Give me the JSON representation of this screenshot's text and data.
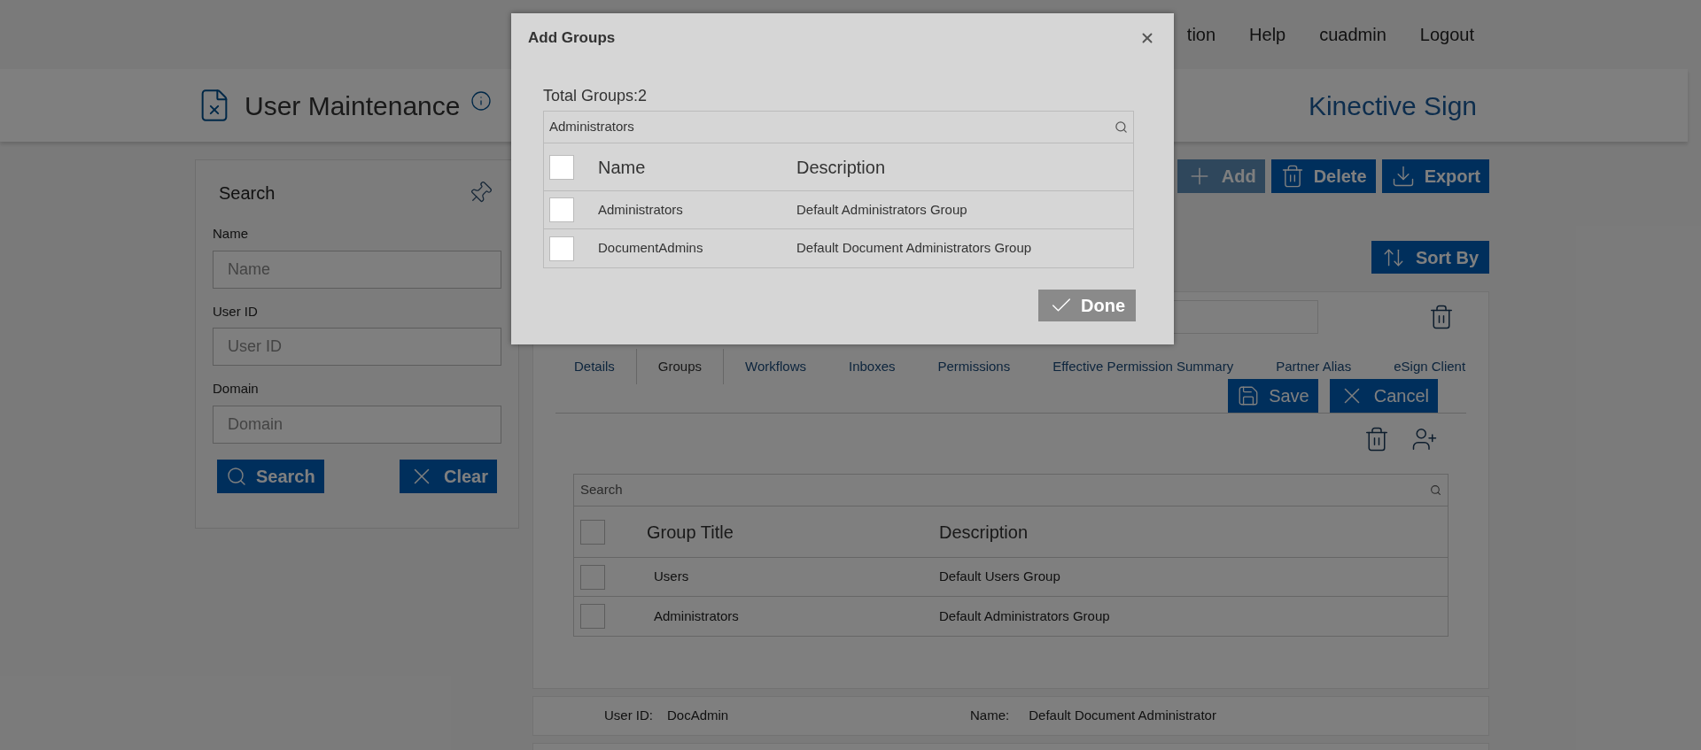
{
  "nav": [
    "tion",
    "Help",
    "cuadmin",
    "Logout"
  ],
  "header": {
    "title": "User Maintenance",
    "brand": "Kinective Sign"
  },
  "search_panel": {
    "title": "Search",
    "fields": [
      {
        "label": "Name",
        "placeholder": "Name"
      },
      {
        "label": "User ID",
        "placeholder": "User ID"
      },
      {
        "label": "Domain",
        "placeholder": "Domain"
      }
    ],
    "buttons": [
      {
        "label": "Search",
        "kind": "search"
      },
      {
        "label": "Clear",
        "kind": "clear"
      }
    ]
  },
  "toolbar": [
    {
      "label": "Add",
      "kind": "add",
      "disabled": true
    },
    {
      "label": "Delete",
      "kind": "delete",
      "disabled": false
    },
    {
      "label": "Export",
      "kind": "export",
      "disabled": false
    }
  ],
  "sort_by": "Sort By",
  "editor": {
    "tabs": [
      {
        "label": "Details",
        "selected": false
      },
      {
        "label": "Groups",
        "selected": true
      },
      {
        "label": "Workflows",
        "selected": false
      },
      {
        "label": "Inboxes",
        "selected": false
      },
      {
        "label": "Permissions",
        "selected": false
      },
      {
        "label": "Effective Permission Summary",
        "selected": false
      },
      {
        "label": "Partner Alias",
        "selected": false
      },
      {
        "label": "eSign Client",
        "selected": false
      }
    ],
    "actions": [
      {
        "label": "Save",
        "kind": "save"
      },
      {
        "label": "Cancel",
        "kind": "cancel"
      }
    ],
    "group_table": {
      "search_placeholder": "Search",
      "columns": [
        "Group Title",
        "Description"
      ],
      "header_checked": false,
      "rows": [
        {
          "cells": [
            "Users",
            "Default Users Group"
          ],
          "checked": false
        },
        {
          "cells": [
            "Administrators",
            "Default Administrators Group"
          ],
          "checked": false
        }
      ]
    }
  },
  "other_users": [
    {
      "user_id_label": "User ID:",
      "user_id": "DocAdmin",
      "name_label": "Name:",
      "name": "Default Document Administrator"
    }
  ],
  "modal": {
    "title": "Add Groups",
    "total": "Total Groups:2",
    "search_value": "Administrators",
    "columns": [
      "Name",
      "Description"
    ],
    "header_checked": false,
    "rows": [
      {
        "cells": [
          "Administrators",
          "Default Administrators Group"
        ],
        "checked": false
      },
      {
        "cells": [
          "DocumentAdmins",
          "Default Document Administrators Group"
        ],
        "checked": false
      }
    ],
    "done": {
      "label": "Done",
      "disabled": true
    }
  }
}
